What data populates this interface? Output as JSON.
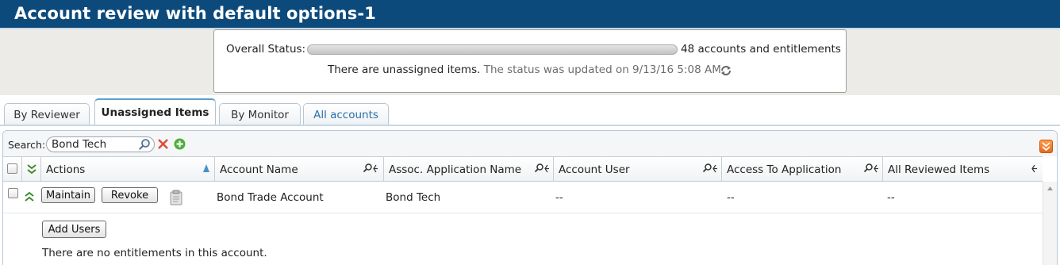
{
  "window": {
    "title": "Account review with default options-1"
  },
  "status": {
    "label": "Overall Status:",
    "progress_fraction": 0.0,
    "count_text": "48 accounts and entitlements",
    "message": "There are unassigned items.",
    "updated_text": "The status was updated on 9/13/16 5:08 AM."
  },
  "tabs": [
    {
      "label": "By Reviewer",
      "active": false
    },
    {
      "label": "Unassigned Items",
      "active": true
    },
    {
      "label": "By Monitor",
      "active": false
    },
    {
      "label": "All accounts",
      "active": false
    }
  ],
  "search": {
    "label": "Search:",
    "value": "Bond Tech"
  },
  "columns": [
    {
      "label": "Actions"
    },
    {
      "label": "Account Name"
    },
    {
      "label": "Assoc. Application Name"
    },
    {
      "label": "Account User"
    },
    {
      "label": "Access To Application"
    },
    {
      "label": "All Reviewed Items"
    }
  ],
  "rows": [
    {
      "actions": {
        "maintain": "Maintain",
        "revoke": "Revoke"
      },
      "account_name": "Bond Trade Account",
      "application": "Bond Tech",
      "account_user": "--",
      "access": "--",
      "reviewed": "--",
      "details": {
        "add_users_label": "Add Users",
        "empty_message": "There are no entitlements in this account."
      }
    }
  ],
  "colors": {
    "titlebar": "#0d4a7c",
    "tab_active_accent": "#5c9ecf",
    "link": "#2a6fa8",
    "toolbar_collapse": "#f07a2a"
  },
  "icons": [
    "refresh-icon",
    "search-icon",
    "clear-icon",
    "add-icon",
    "expand-all-icon",
    "collapse-row-icon",
    "clipboard-icon",
    "sort-asc-icon",
    "column-search-icon",
    "column-menu-icon",
    "collapse-panel-icon"
  ]
}
